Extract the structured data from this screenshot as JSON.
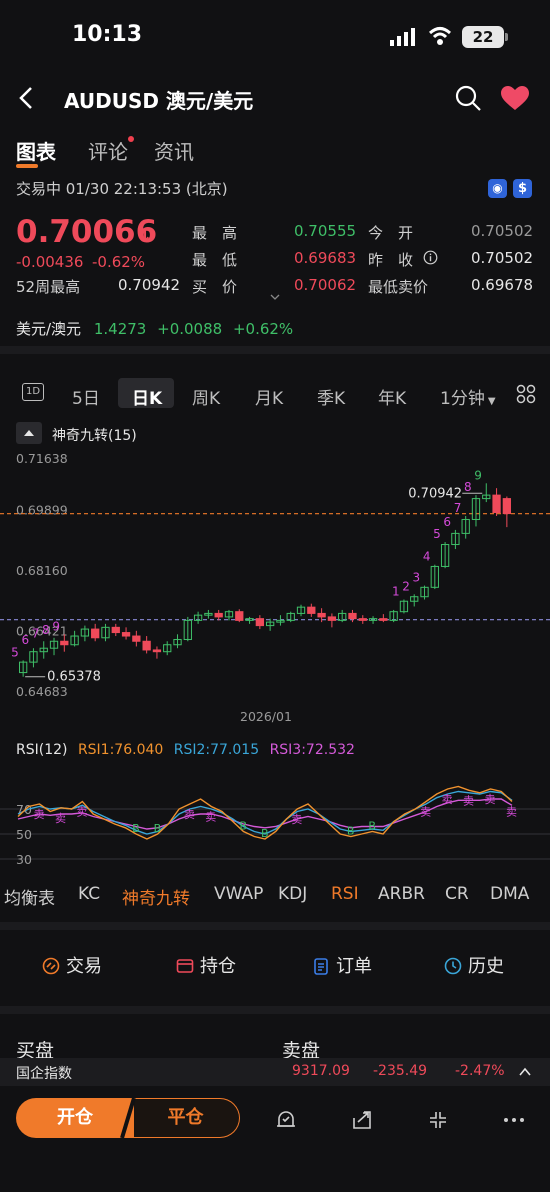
{
  "status_bar": {
    "time": "10:13",
    "battery": "22"
  },
  "header": {
    "title": "AUDUSD  澳元/美元"
  },
  "tabs": [
    {
      "label": "图表"
    },
    {
      "label": "评论"
    },
    {
      "label": "资讯"
    }
  ],
  "session": {
    "text": "交易中 01/30 22:13:53 (北京)"
  },
  "quote": {
    "price": "0.70066",
    "change": "-0.00436",
    "change_pct": "-0.62%",
    "wk52_label": "52周最高",
    "wk52_value": "0.70942",
    "high_label": "最　高",
    "high_value": "0.70555",
    "low_label": "最　低",
    "low_value": "0.69683",
    "buy_label": "买　价",
    "buy_value": "0.70062",
    "open_label": "今　开",
    "open_value": "0.70502",
    "prev_label": "昨　收",
    "prev_value": "0.70502",
    "minsell_label": "最低卖价",
    "minsell_value": "0.69678"
  },
  "related": {
    "name": "美元/澳元",
    "value": "1.4273",
    "change": "+0.0088",
    "pct": "+0.62%"
  },
  "periods": [
    {
      "label": "1D"
    },
    {
      "label": "5日"
    },
    {
      "label": "日K"
    },
    {
      "label": "周K"
    },
    {
      "label": "月K"
    },
    {
      "label": "季K"
    },
    {
      "label": "年K"
    },
    {
      "label": "1分钟"
    }
  ],
  "indicator_button": "神奇九转(15)",
  "chart_data": {
    "type": "candlestick",
    "title": "",
    "y_ticks": [
      "0.71638",
      "0.69899",
      "0.68160",
      "0.66421",
      "0.64683"
    ],
    "ylim": [
      0.64683,
      0.71638
    ],
    "x_label": "2026/01",
    "annotations": {
      "max": "0.70942",
      "min": "0.65378"
    },
    "last_price_line": 0.70066,
    "reference_line": 0.6702,
    "td_sequence_top": [
      "1",
      "2",
      "3",
      "4",
      "5",
      "6",
      "7",
      "8",
      "9"
    ],
    "td_sequence_left": [
      "5",
      "6",
      "7",
      "8",
      "9"
    ],
    "candles": [
      [
        0.655,
        0.6585,
        0.6538,
        0.658
      ],
      [
        0.658,
        0.662,
        0.6565,
        0.661
      ],
      [
        0.661,
        0.664,
        0.659,
        0.662
      ],
      [
        0.662,
        0.665,
        0.66,
        0.664
      ],
      [
        0.664,
        0.666,
        0.661,
        0.663
      ],
      [
        0.663,
        0.667,
        0.6625,
        0.6655
      ],
      [
        0.6655,
        0.6685,
        0.664,
        0.6675
      ],
      [
        0.6675,
        0.669,
        0.664,
        0.665
      ],
      [
        0.665,
        0.669,
        0.664,
        0.668
      ],
      [
        0.668,
        0.669,
        0.6655,
        0.6665
      ],
      [
        0.6665,
        0.668,
        0.6645,
        0.6655
      ],
      [
        0.6655,
        0.667,
        0.6625,
        0.664
      ],
      [
        0.664,
        0.6655,
        0.6605,
        0.6615
      ],
      [
        0.6615,
        0.6625,
        0.659,
        0.661
      ],
      [
        0.661,
        0.664,
        0.66,
        0.663
      ],
      [
        0.663,
        0.666,
        0.662,
        0.6645
      ],
      [
        0.6645,
        0.671,
        0.664,
        0.67
      ],
      [
        0.67,
        0.6725,
        0.669,
        0.6715
      ],
      [
        0.6715,
        0.673,
        0.6705,
        0.672
      ],
      [
        0.672,
        0.673,
        0.67,
        0.671
      ],
      [
        0.671,
        0.673,
        0.67,
        0.6725
      ],
      [
        0.6725,
        0.6732,
        0.6695,
        0.67
      ],
      [
        0.67,
        0.671,
        0.669,
        0.6705
      ],
      [
        0.6705,
        0.6715,
        0.6675,
        0.6685
      ],
      [
        0.6685,
        0.6705,
        0.667,
        0.6695
      ],
      [
        0.6695,
        0.6715,
        0.6685,
        0.67
      ],
      [
        0.67,
        0.6725,
        0.6695,
        0.672
      ],
      [
        0.672,
        0.6745,
        0.6712,
        0.6738
      ],
      [
        0.6738,
        0.6748,
        0.671,
        0.672
      ],
      [
        0.672,
        0.6735,
        0.6695,
        0.671
      ],
      [
        0.671,
        0.672,
        0.668,
        0.67
      ],
      [
        0.67,
        0.673,
        0.6695,
        0.672
      ],
      [
        0.672,
        0.673,
        0.6695,
        0.6705
      ],
      [
        0.6705,
        0.6715,
        0.669,
        0.67
      ],
      [
        0.67,
        0.6712,
        0.669,
        0.6705
      ],
      [
        0.6705,
        0.6718,
        0.6695,
        0.67
      ],
      [
        0.67,
        0.673,
        0.6695,
        0.6725
      ],
      [
        0.6725,
        0.676,
        0.672,
        0.6755
      ],
      [
        0.6755,
        0.6775,
        0.674,
        0.6768
      ],
      [
        0.6768,
        0.68,
        0.676,
        0.6795
      ],
      [
        0.6795,
        0.686,
        0.679,
        0.6855
      ],
      [
        0.6855,
        0.6925,
        0.685,
        0.6918
      ],
      [
        0.6918,
        0.696,
        0.6905,
        0.695
      ],
      [
        0.695,
        0.7,
        0.6935,
        0.699
      ],
      [
        0.699,
        0.706,
        0.697,
        0.705
      ],
      [
        0.705,
        0.7094,
        0.704,
        0.706
      ],
      [
        0.706,
        0.708,
        0.7,
        0.701
      ],
      [
        0.705,
        0.7056,
        0.6968,
        0.7007
      ]
    ]
  },
  "rsi": {
    "legend": "RSI(12)",
    "rsi1": "RSI1:76.040",
    "rsi2": "RSI2:77.015",
    "rsi3": "RSI3:72.532",
    "levels": [
      "70",
      "50",
      "30"
    ],
    "sell_marker": "卖",
    "buy_marker": "B",
    "series1": [
      64,
      72,
      74,
      68,
      71,
      70,
      76,
      66,
      62,
      58,
      55,
      50,
      46,
      50,
      58,
      70,
      74,
      78,
      72,
      68,
      60,
      52,
      48,
      46,
      52,
      62,
      70,
      74,
      66,
      58,
      50,
      48,
      50,
      52,
      50,
      60,
      66,
      70,
      76,
      82,
      86,
      88,
      85,
      83,
      86,
      84,
      76
    ],
    "series2": [
      66,
      70,
      72,
      70,
      71,
      70,
      73,
      68,
      64,
      60,
      57,
      53,
      50,
      52,
      58,
      66,
      70,
      72,
      70,
      67,
      62,
      56,
      52,
      50,
      54,
      62,
      68,
      70,
      66,
      60,
      54,
      52,
      53,
      54,
      53,
      60,
      65,
      70,
      74,
      79,
      82,
      84,
      83,
      82,
      84,
      83,
      77
    ],
    "series3": [
      62,
      64,
      66,
      65,
      66,
      66,
      67,
      64,
      62,
      60,
      58,
      56,
      54,
      55,
      58,
      62,
      65,
      66,
      66,
      64,
      61,
      58,
      56,
      55,
      56,
      59,
      62,
      64,
      62,
      60,
      57,
      55,
      56,
      56,
      56,
      59,
      62,
      65,
      68,
      72,
      75,
      77,
      77,
      77,
      78,
      78,
      73
    ]
  },
  "indicator_tabs": [
    "均衡表",
    "KC",
    "神奇九转",
    "VWAP",
    "KDJ",
    "RSI",
    "ARBR",
    "CR",
    "DMA"
  ],
  "actions": [
    {
      "label": "交易"
    },
    {
      "label": "持仓"
    },
    {
      "label": "订单"
    },
    {
      "label": "历史"
    }
  ],
  "orderbook": {
    "bid": "买盘",
    "ask": "卖盘"
  },
  "ticker": {
    "name": "国企指数",
    "value": "9317.09",
    "change": "-235.49",
    "pct": "-2.47%"
  },
  "bottom": {
    "open": "开仓",
    "close": "平仓"
  },
  "colors": {
    "up": "#3fbf68",
    "down": "#ef4a5a",
    "accent": "#f07a2a",
    "rsi1": "#f0922e",
    "rsi2": "#3aa6d8",
    "rsi3": "#d45ad8"
  }
}
